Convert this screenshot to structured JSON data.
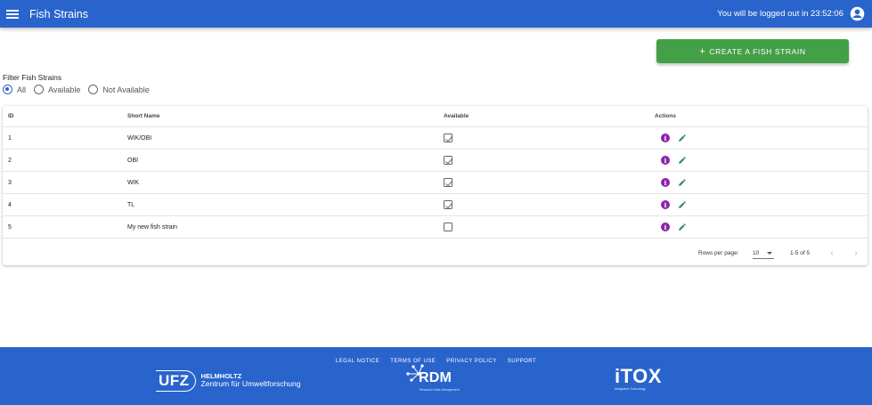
{
  "appbar": {
    "title": "Fish Strains",
    "logout_text": "You will be logged out in  23:52:06",
    "menu_icon": "hamburger-menu-icon",
    "account_icon": "account-circle-icon",
    "color": "#2964cc"
  },
  "create_button": {
    "label": "CREATE A FISH STRAIN",
    "plus": "+",
    "color": "#43a047"
  },
  "filter": {
    "title": "Filter Fish Strains",
    "options": [
      {
        "label": "All",
        "checked": true
      },
      {
        "label": "Available",
        "checked": false
      },
      {
        "label": "Not Available",
        "checked": false
      }
    ]
  },
  "table": {
    "headers": {
      "id": "ID",
      "short_name": "Short Name",
      "available": "Available",
      "actions": "Actions"
    },
    "rows": [
      {
        "id": "1",
        "short_name": "WIK/OBI",
        "available": true
      },
      {
        "id": "2",
        "short_name": "OBI",
        "available": true
      },
      {
        "id": "3",
        "short_name": "WIK",
        "available": true
      },
      {
        "id": "4",
        "short_name": "TL",
        "available": true
      },
      {
        "id": "5",
        "short_name": "My new fish strain",
        "available": false
      }
    ],
    "action_icons": [
      "info-icon",
      "edit-pencil-icon"
    ],
    "info_color": "#8e24aa",
    "edit_color": "#2e8b57"
  },
  "pagination": {
    "rows_per_page_label": "Rows per page:",
    "rows_per_page_value": "10",
    "range": "1-5 of 5",
    "prev": "‹",
    "next": "›"
  },
  "footer": {
    "links": [
      "LEGAL NOTICE",
      "TERMS OF USE",
      "PRIVACY POLICY",
      "SUPPORT"
    ],
    "ufz": {
      "mark": "UFZ",
      "line1": "HELMHOLTZ",
      "line2": "Zentrum für Umweltforschung"
    },
    "rdm": {
      "word": "RDM",
      "sub": "Research Data Management"
    },
    "itox": {
      "word": "iTOX",
      "sub": "Integrative Toxicology"
    }
  }
}
